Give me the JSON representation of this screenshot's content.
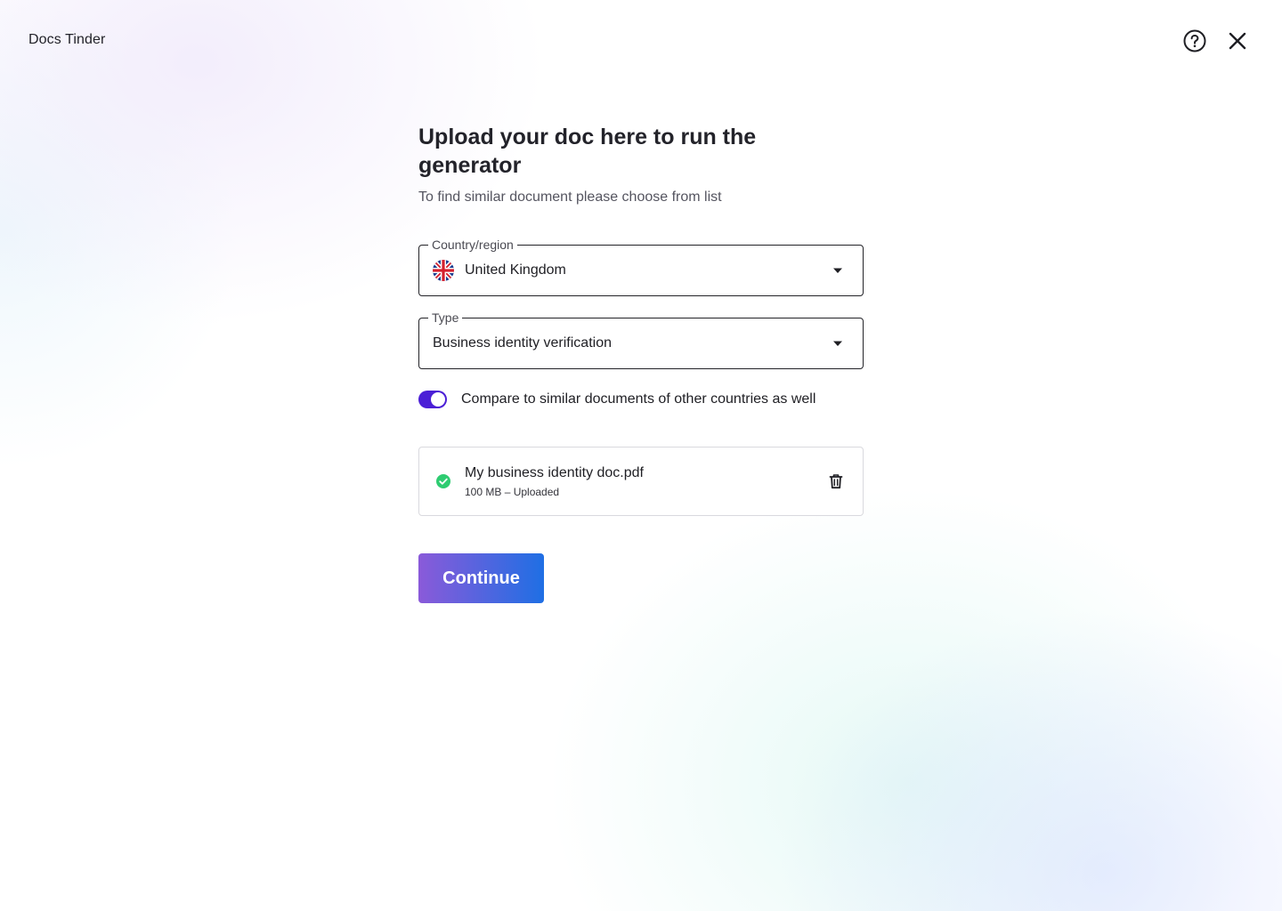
{
  "app": {
    "title": "Docs Tinder"
  },
  "header": {
    "help_icon": "help-circle-icon",
    "close_icon": "close-icon"
  },
  "main": {
    "title": "Upload your doc here to run the generator",
    "subtitle": "To find similar document please choose from list",
    "country": {
      "label": "Country/region",
      "value": "United Kingdom",
      "flag_icon": "uk-flag-icon"
    },
    "type": {
      "label": "Type",
      "value": "Business identity verification"
    },
    "compare_toggle": {
      "label": "Compare to similar documents of other countries as well",
      "checked": true
    },
    "file": {
      "name": "My business identity doc.pdf",
      "meta": "100 MB – Uploaded",
      "status_icon": "check-circle-icon",
      "delete_icon": "trash-icon"
    },
    "continue_label": "Continue"
  },
  "colors": {
    "accent": "#4b1fd6",
    "success": "#2ecc71",
    "button_gradient_start": "#8a5ad9",
    "button_gradient_end": "#1f6fe4"
  }
}
